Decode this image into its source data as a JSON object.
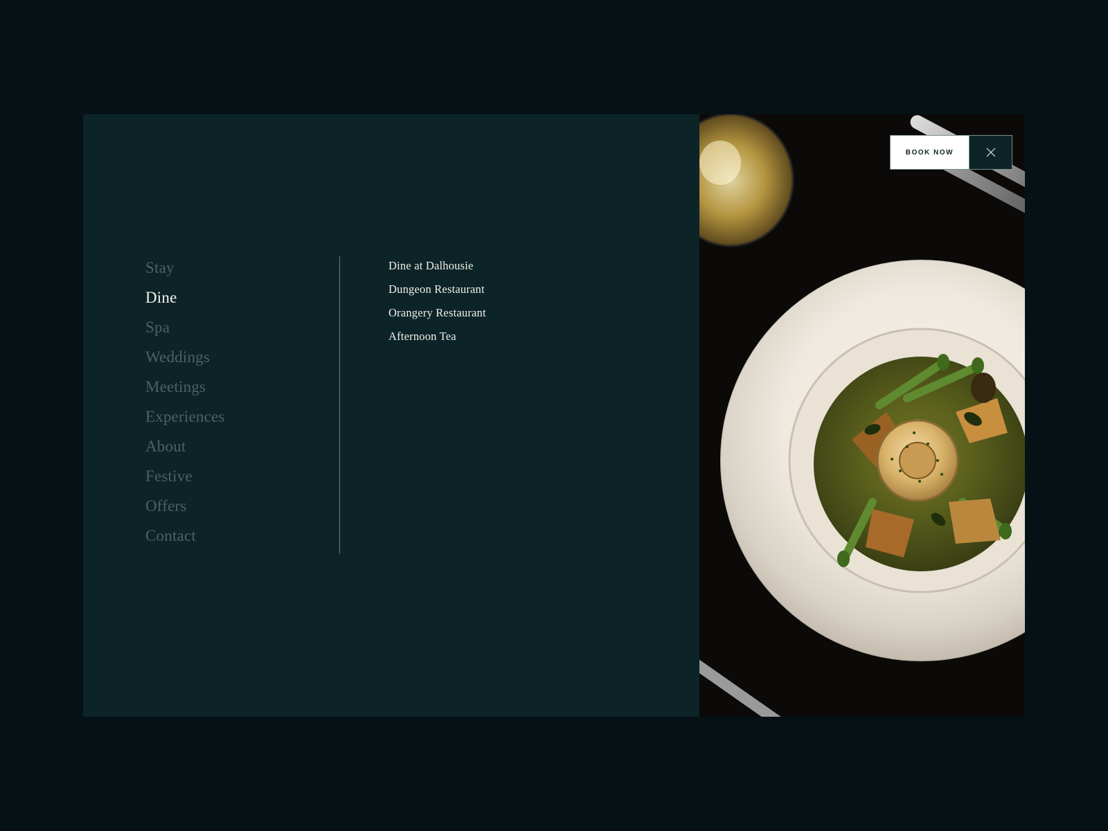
{
  "nav": {
    "items": [
      {
        "label": "Stay",
        "active": false
      },
      {
        "label": "Dine",
        "active": true
      },
      {
        "label": "Spa",
        "active": false
      },
      {
        "label": "Weddings",
        "active": false
      },
      {
        "label": "Meetings",
        "active": false
      },
      {
        "label": "Experiences",
        "active": false
      },
      {
        "label": "About",
        "active": false
      },
      {
        "label": "Festive",
        "active": false
      },
      {
        "label": "Offers",
        "active": false
      },
      {
        "label": "Contact",
        "active": false
      }
    ]
  },
  "subnav": {
    "items": [
      {
        "label": "Dine at Dalhousie"
      },
      {
        "label": "Dungeon Restaurant"
      },
      {
        "label": "Orangery Restaurant"
      },
      {
        "label": "Afternoon Tea"
      }
    ]
  },
  "actions": {
    "book_label": "BOOK NOW"
  },
  "colors": {
    "page_bg": "#051114",
    "panel_bg": "#0c2428",
    "text_active": "#f5f3ee",
    "text_muted": "#4a6266"
  }
}
